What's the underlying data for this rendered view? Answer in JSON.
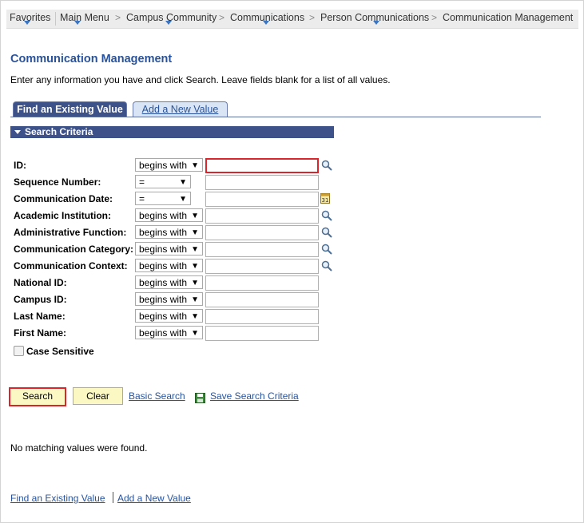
{
  "breadcrumb": {
    "items": [
      "Favorites",
      "Main Menu",
      "Campus Community",
      "Communications",
      "Person Communications",
      "Communication Management"
    ],
    "separator": ">"
  },
  "page": {
    "title": "Communication Management",
    "instructions": "Enter any information you have and click Search. Leave fields blank for a list of all values."
  },
  "tabs": {
    "find_existing": "Find an Existing Value",
    "add_new": "Add a New Value"
  },
  "search_criteria": {
    "header": "Search Criteria",
    "fields": [
      {
        "label": "ID:",
        "operator": "begins with",
        "value": "",
        "lookup": true
      },
      {
        "label": "Sequence Number:",
        "operator": "=",
        "value": ""
      },
      {
        "label": "Communication Date:",
        "operator": "=",
        "value": "",
        "calendar": true
      },
      {
        "label": "Academic Institution:",
        "operator": "begins with",
        "value": "",
        "lookup": true
      },
      {
        "label": "Administrative Function:",
        "operator": "begins with",
        "value": "",
        "lookup": true
      },
      {
        "label": "Communication Category:",
        "operator": "begins with",
        "value": "",
        "lookup": true
      },
      {
        "label": "Communication Context:",
        "operator": "begins with",
        "value": "",
        "lookup": true
      },
      {
        "label": "National ID:",
        "operator": "begins with",
        "value": ""
      },
      {
        "label": "Campus ID:",
        "operator": "begins with",
        "value": ""
      },
      {
        "label": "Last Name:",
        "operator": "begins with",
        "value": ""
      },
      {
        "label": "First Name:",
        "operator": "begins with",
        "value": ""
      }
    ],
    "case_sensitive_label": "Case Sensitive",
    "case_sensitive_checked": false
  },
  "actions": {
    "search": "Search",
    "clear": "Clear",
    "basic_search": "Basic Search",
    "save_search_criteria": "Save Search Criteria"
  },
  "result_message": "No matching values were found.",
  "footer": {
    "find_existing": "Find an Existing Value",
    "add_new": "Add a New Value"
  },
  "icons": {
    "lookup": "magnifier-icon",
    "calendar": "calendar-icon",
    "save": "floppy-disk-icon",
    "dropdown": "chevron-down-icon"
  },
  "colors": {
    "title_blue": "#28539c",
    "tab_active_bg": "#3d5289",
    "button_yellow": "#fcf8c4",
    "highlight_red": "#d9262c"
  }
}
